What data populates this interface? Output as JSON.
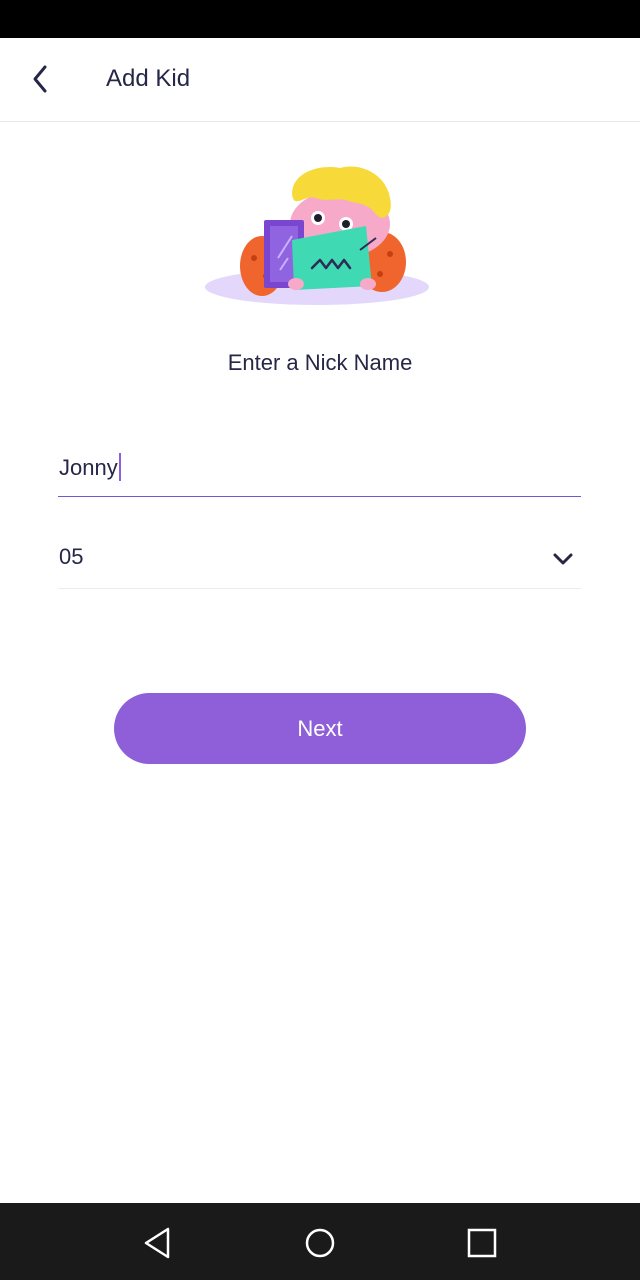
{
  "header": {
    "title": "Add Kid",
    "back_icon": "chevron-left-icon"
  },
  "main": {
    "illustration": "kid-with-tablet-illustration",
    "prompt": "Enter a Nick Name",
    "name_input": {
      "value": "Jonny"
    },
    "age_select": {
      "value": "05",
      "icon": "chevron-down-icon"
    },
    "next_label": "Next"
  },
  "colors": {
    "accent": "#8e5fd8",
    "text": "#262647",
    "input_underline": "#6b5bd2",
    "nav_bar": "#1a1a1a"
  },
  "system_nav": {
    "back_icon": "triangle-back-icon",
    "home_icon": "circle-home-icon",
    "recents_icon": "square-recents-icon"
  }
}
